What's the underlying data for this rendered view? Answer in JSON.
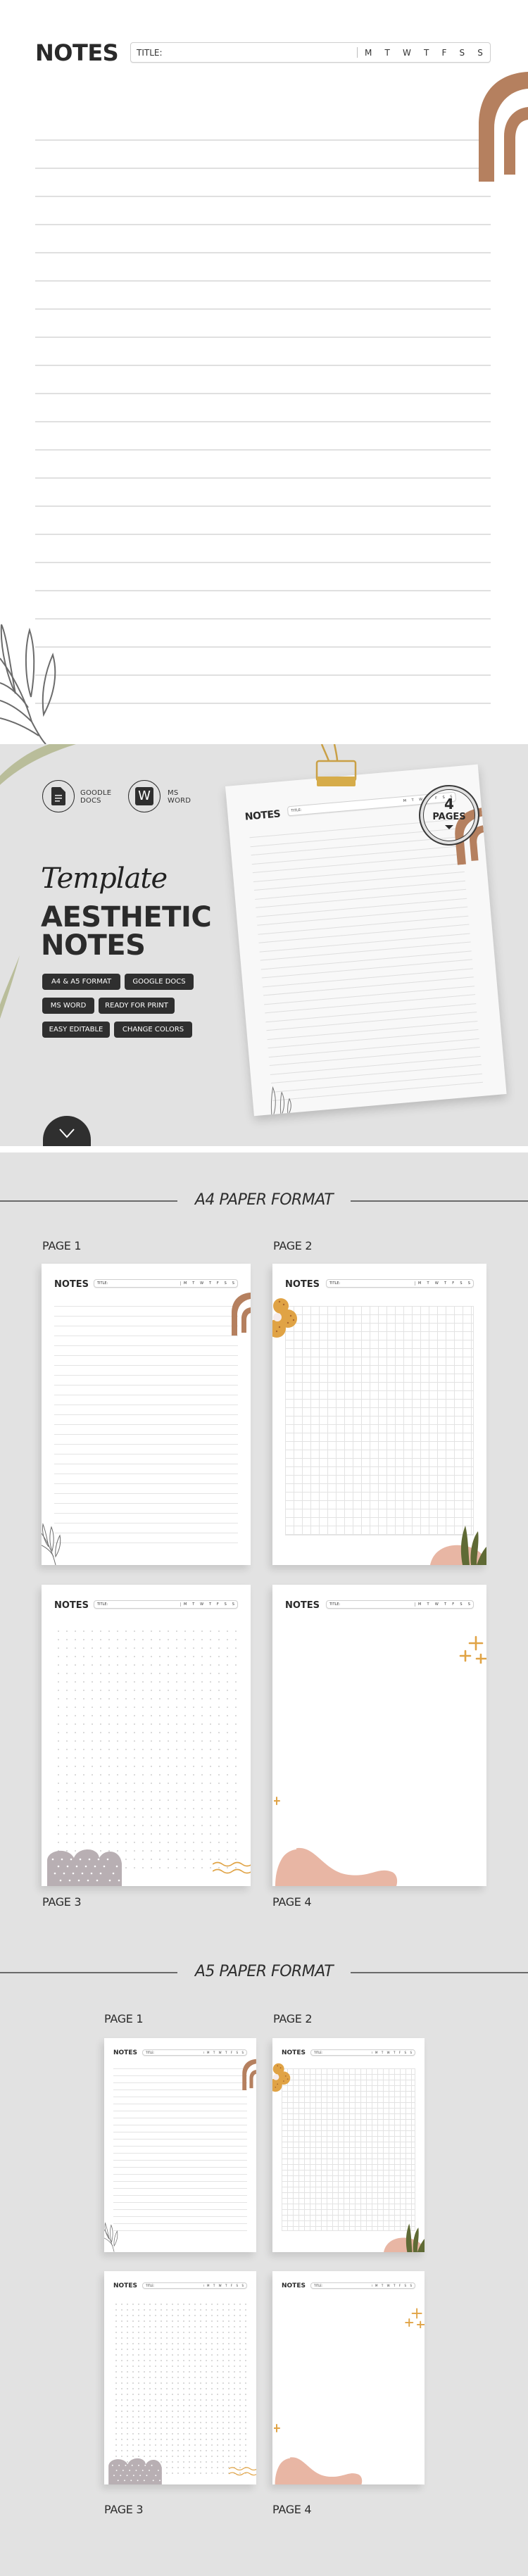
{
  "notes_page": {
    "heading": "NOTES",
    "title_label": "TITLE:",
    "days": [
      "M",
      "T",
      "W",
      "T",
      "F",
      "S",
      "S"
    ]
  },
  "hero": {
    "apps": [
      {
        "icon": "google-docs-icon",
        "label_line1": "GOODLE",
        "label_line2": "DOCS"
      },
      {
        "icon": "ms-word-icon",
        "glyph": "W",
        "label_line1": "MS",
        "label_line2": "WORD"
      }
    ],
    "script_title": "Template",
    "title_line1": "AESTHETIC",
    "title_line2": "NOTES",
    "tags": [
      "A4 & A5 FORMAT",
      "GOOGLE DOCS",
      "MS WORD",
      "READY FOR PRINT",
      "EASY EDITABLE",
      "CHANGE COLORS"
    ],
    "badge_number": "4",
    "badge_label": "PAGES",
    "scroll_icon": "chevron-down-icon"
  },
  "a4": {
    "heading": "A4 PAPER FORMAT",
    "pages": [
      {
        "label": "PAGE 1",
        "style": "lined"
      },
      {
        "label": "PAGE 2",
        "style": "grid"
      },
      {
        "label": "PAGE 3",
        "style": "dotted"
      },
      {
        "label": "PAGE 4",
        "style": "blank"
      }
    ]
  },
  "a5": {
    "heading": "A5 PAPER FORMAT",
    "pages": [
      {
        "label": "PAGE 1",
        "style": "lined"
      },
      {
        "label": "PAGE 2",
        "style": "grid"
      },
      {
        "label": "PAGE 3",
        "style": "dotted"
      },
      {
        "label": "PAGE 4",
        "style": "blank"
      }
    ]
  },
  "colors": {
    "background": "#e2e2e2",
    "dark": "#2f2f2f",
    "terracotta": "#b5805f",
    "mustard": "#e0a345",
    "blush": "#e8b6a4",
    "olive": "#5f6a35",
    "mauve": "#b8afb3"
  }
}
